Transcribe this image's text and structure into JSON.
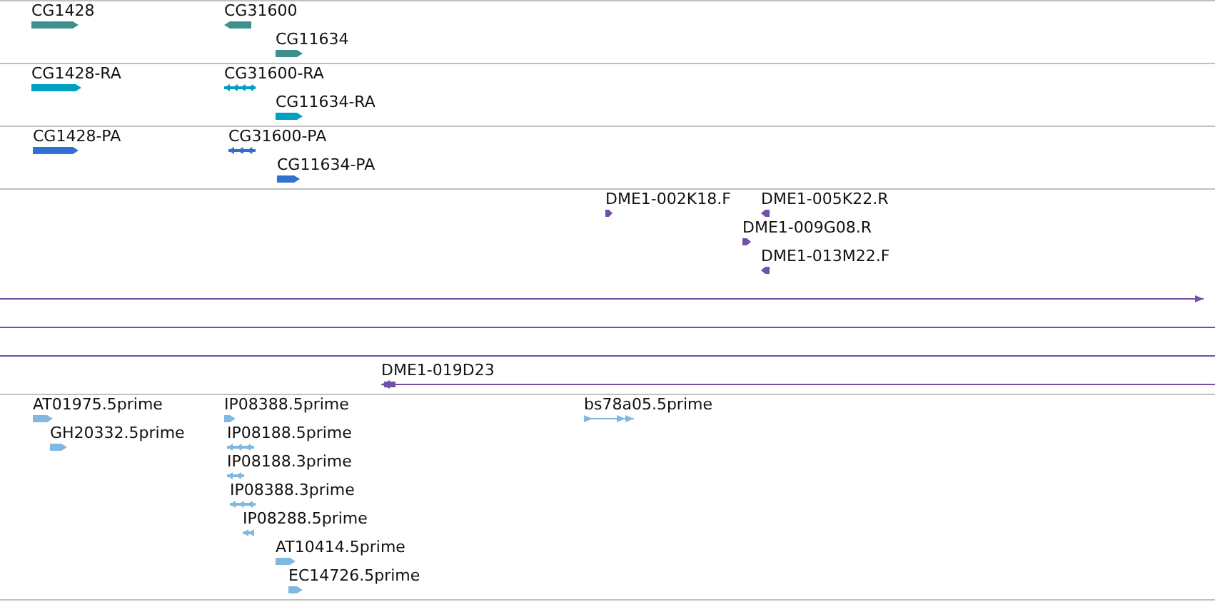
{
  "tracks": [
    {
      "color": "#408f90",
      "features": [
        {
          "label": "CG1428",
          "reverse": false,
          "kind": "block"
        },
        {
          "label": "CG31600",
          "reverse": true,
          "kind": "block"
        },
        {
          "label": "CG11634",
          "reverse": false,
          "kind": "block"
        }
      ]
    },
    {
      "color": "#00a0c0",
      "features": [
        {
          "label": "CG1428-RA",
          "reverse": false,
          "kind": "block"
        },
        {
          "label": "CG31600-RA",
          "reverse": true,
          "kind": "segmented"
        },
        {
          "label": "CG11634-RA",
          "reverse": false,
          "kind": "block"
        }
      ]
    },
    {
      "color": "#3070d0",
      "features": [
        {
          "label": "CG1428-PA",
          "reverse": false,
          "kind": "block"
        },
        {
          "label": "CG31600-PA",
          "reverse": true,
          "kind": "segmented"
        },
        {
          "label": "CG11634-PA",
          "reverse": false,
          "kind": "block"
        }
      ]
    },
    {
      "color": "#7050a8",
      "features": [
        {
          "label": "DME1-002K18.F",
          "reverse": false,
          "kind": "block"
        },
        {
          "label": "DME1-005K22.R",
          "reverse": true,
          "kind": "block"
        },
        {
          "label": "DME1-009G08.R",
          "reverse": false,
          "kind": "block"
        },
        {
          "label": "DME1-013M22.F",
          "reverse": true,
          "kind": "block"
        },
        {
          "reverse": false,
          "kind": "line"
        },
        {
          "kind": "plain"
        },
        {
          "kind": "plain"
        },
        {
          "label": "DME1-019D23",
          "reverse": true,
          "kind": "line"
        }
      ]
    },
    {
      "color": "#80b8e0",
      "features": [
        {
          "label": "AT01975.5prime",
          "reverse": false,
          "kind": "block"
        },
        {
          "label": "IP08388.5prime",
          "reverse": false,
          "kind": "block"
        },
        {
          "label": "bs78a05.5prime",
          "reverse": false,
          "kind": "linked"
        },
        {
          "label": "GH20332.5prime",
          "reverse": false,
          "kind": "block"
        },
        {
          "label": "IP08188.5prime",
          "reverse": true,
          "kind": "segmented"
        },
        {
          "label": "IP08188.3prime",
          "reverse": true,
          "kind": "segmented"
        },
        {
          "label": "IP08388.3prime",
          "reverse": true,
          "kind": "segmented"
        },
        {
          "label": "IP08288.5prime",
          "reverse": true,
          "kind": "segmented"
        },
        {
          "label": "AT10414.5prime",
          "reverse": false,
          "kind": "block"
        },
        {
          "label": "EC14726.5prime",
          "reverse": false,
          "kind": "block"
        }
      ]
    }
  ]
}
